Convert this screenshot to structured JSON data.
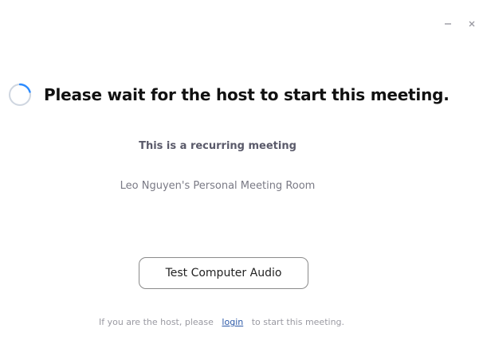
{
  "window": {
    "controls": {
      "minimize_icon": "minimize-icon",
      "close_icon": "close-icon"
    }
  },
  "main": {
    "spinner_icon": "loading-spinner-icon",
    "title": "Please wait for the host to start this meeting.",
    "subtitle": "This is a recurring meeting",
    "room_name": "Leo Nguyen's Personal Meeting Room",
    "test_audio_button": "Test Computer Audio"
  },
  "footer": {
    "prefix": "If you are the host, please",
    "login_link": "login",
    "suffix": "to start this meeting."
  },
  "colors": {
    "spinner_accent": "#2d8cff",
    "spinner_track": "#cfd6e0",
    "link": "#2d5aa8"
  }
}
